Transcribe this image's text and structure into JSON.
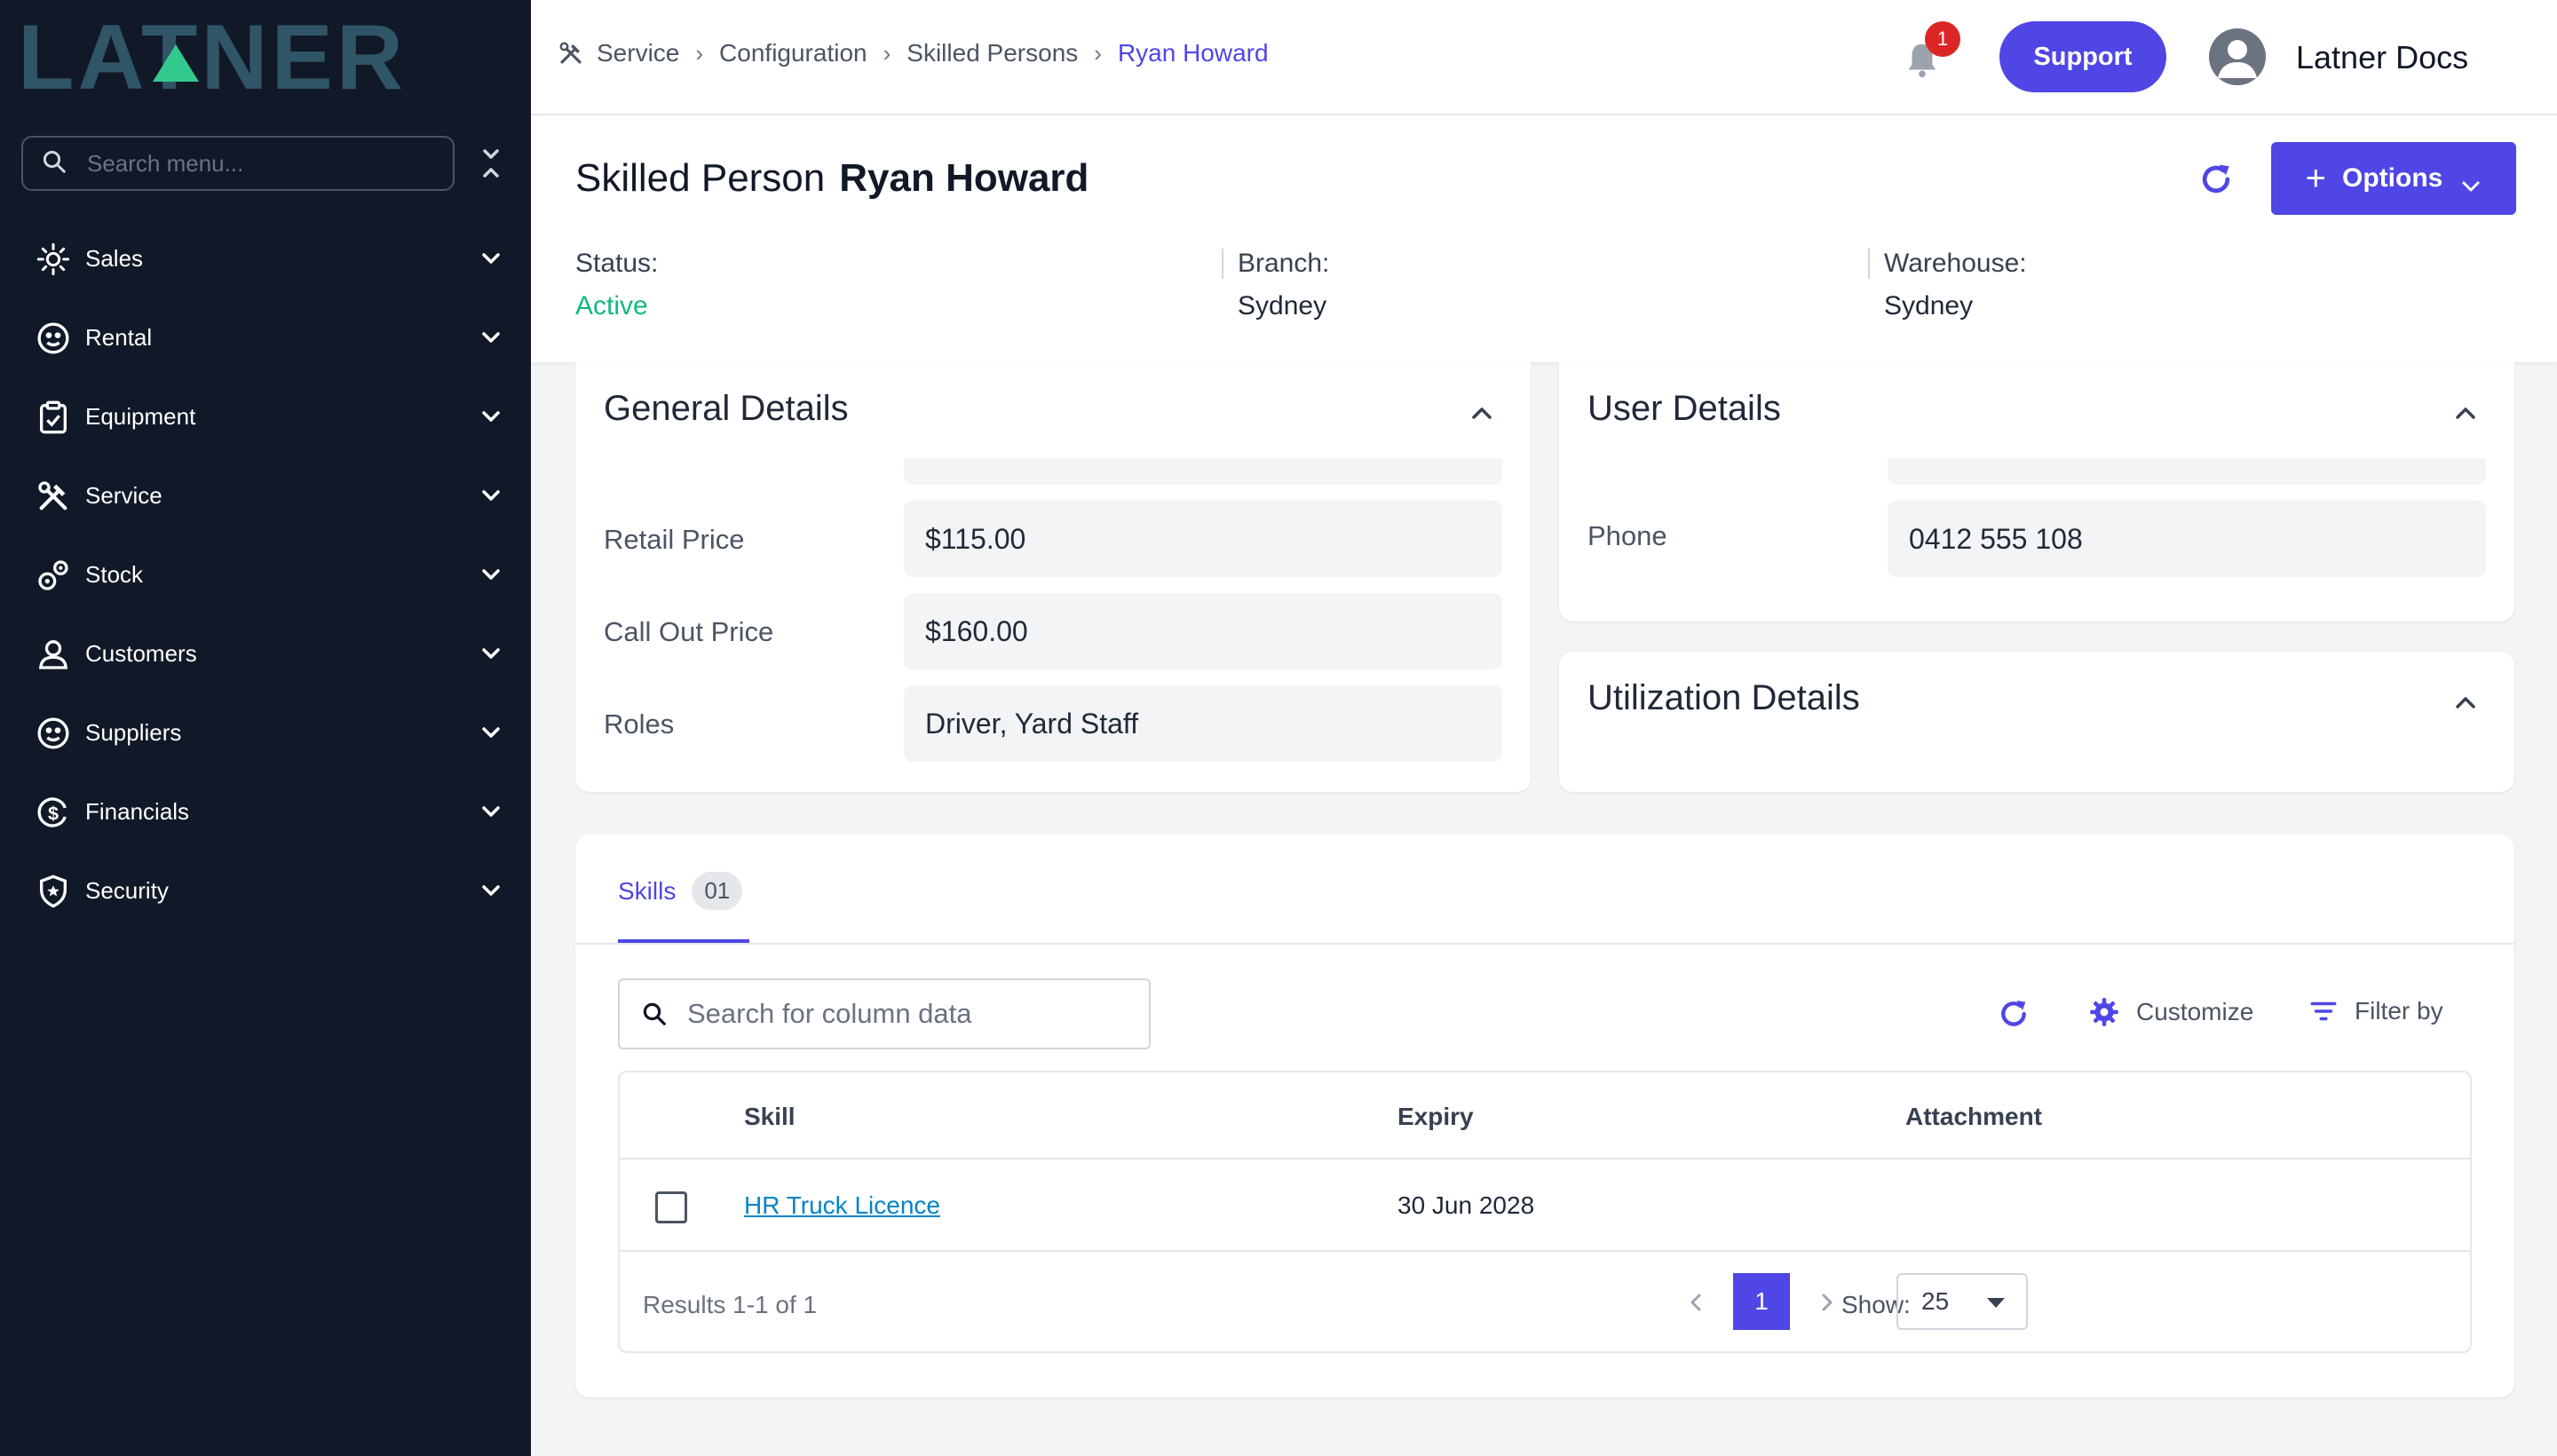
{
  "brand": {
    "logo_text": "LATNER"
  },
  "sidebar": {
    "search_placeholder": "Search menu...",
    "items": [
      {
        "label": "Sales",
        "icon": "sales-icon"
      },
      {
        "label": "Rental",
        "icon": "rental-icon"
      },
      {
        "label": "Equipment",
        "icon": "clipboard-icon"
      },
      {
        "label": "Service",
        "icon": "tools-icon"
      },
      {
        "label": "Stock",
        "icon": "stock-icon"
      },
      {
        "label": "Customers",
        "icon": "person-icon"
      },
      {
        "label": "Suppliers",
        "icon": "suppliers-icon"
      },
      {
        "label": "Financials",
        "icon": "dollar-icon"
      },
      {
        "label": "Security",
        "icon": "shield-icon"
      }
    ]
  },
  "topbar": {
    "breadcrumb": [
      "Service",
      "Configuration",
      "Skilled Persons",
      "Ryan Howard"
    ],
    "notification_count": "1",
    "support_label": "Support",
    "user_name": "Latner Docs"
  },
  "header": {
    "title_prefix": "Skilled Person",
    "title_name": "Ryan Howard",
    "options_label": "Options",
    "status_label": "Status:",
    "status_value": "Active",
    "branch_label": "Branch:",
    "branch_value": "Sydney",
    "warehouse_label": "Warehouse:",
    "warehouse_value": "Sydney"
  },
  "general_details": {
    "title": "General Details",
    "fields": [
      {
        "label": "Retail Price",
        "value": "$115.00"
      },
      {
        "label": "Call Out Price",
        "value": "$160.00"
      },
      {
        "label": "Roles",
        "value": "Driver, Yard Staff"
      }
    ]
  },
  "user_details": {
    "title": "User Details",
    "fields": [
      {
        "label": "Phone",
        "value": "0412 555 108"
      }
    ]
  },
  "utilization_details": {
    "title": "Utilization Details"
  },
  "skills": {
    "tab_label": "Skills",
    "tab_count": "01",
    "search_placeholder": "Search for column data",
    "customize_label": "Customize",
    "filter_label": "Filter by",
    "columns": [
      "Skill",
      "Expiry",
      "Attachment"
    ],
    "rows": [
      {
        "skill": "HR Truck Licence",
        "expiry": "30 Jun 2028",
        "attachment": ""
      }
    ],
    "results_text": "Results 1-1 of 1",
    "current_page": "1",
    "show_label": "Show:",
    "page_size": "25"
  },
  "colors": {
    "sidebar_bg": "#111827",
    "accent": "#4f46e5",
    "active_status": "#10b981",
    "link": "#0284c7",
    "badge": "#dc2626"
  }
}
